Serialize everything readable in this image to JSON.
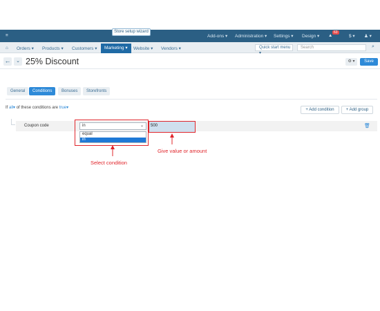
{
  "topbar": {
    "menu_glyph": "≡",
    "wizard": "Store setup wizard",
    "addons": "Add-ons ▾",
    "administration": "Administration ▾",
    "settings": "Settings ▾",
    "design": "Design ▾",
    "notifications_badge": "63",
    "currency": "$ ▾",
    "user": "♟ ▾"
  },
  "nav": {
    "home_icon": "home-icon",
    "orders": "Orders ▾",
    "products": "Products ▾",
    "customers": "Customers ▾",
    "marketing": "Marketing ▾",
    "website": "Website ▾",
    "vendors": "Vendors ▾",
    "quick_start": "Quick start menu ▾",
    "search_placeholder": "Search"
  },
  "titlebar": {
    "back": "←",
    "dropdown": "⌄",
    "title": "25% Discount",
    "gear": "⚙ ▾",
    "save": "Save"
  },
  "tabs": [
    {
      "label": "General"
    },
    {
      "label": "Conditions"
    },
    {
      "label": "Bonuses"
    },
    {
      "label": "Storefronts"
    }
  ],
  "conditions": {
    "prefix": "If",
    "all": "all",
    "middle": "of these conditions are",
    "truth": "true",
    "add_condition": "+ Add condition",
    "add_group": "+ Add group"
  },
  "rule": {
    "label": "Coupon code",
    "operator_selected": "in",
    "operator_options": [
      "equal",
      "in"
    ],
    "value": "500",
    "trash_icon": "trash-icon"
  },
  "annotations": {
    "select_condition": "Select condition",
    "give_value": "Give value or amount"
  },
  "colors": {
    "topbar": "#2b5f84",
    "accent": "#2e8ad8",
    "annotation_red": "#e0242a"
  }
}
